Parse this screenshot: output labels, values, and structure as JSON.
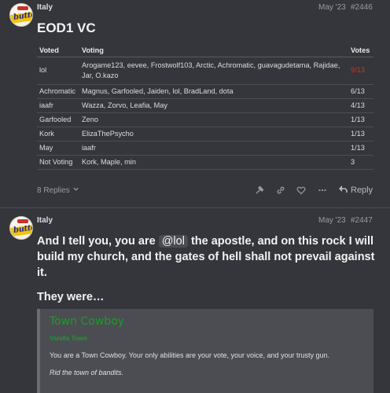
{
  "post1": {
    "username": "Italy",
    "date": "May '23",
    "post_number": "#2446",
    "title": "EOD1 VC",
    "table": {
      "headers": [
        "Voted",
        "Voting",
        "Votes"
      ],
      "rows": [
        {
          "voted": "lol",
          "voting": "Arogame123, eevee, Frostwolf103, Arctic, Achromatic, guavagudetama, Rajidae, Jar, O.kazo",
          "votes": "9/13"
        },
        {
          "voted": "Achromatic",
          "voting": "Magnus, Garfooled, Jaiden, lol, BradLand, dota",
          "votes": "6/13"
        },
        {
          "voted": "iaafr",
          "voting": "Wazza, Zorvo, Leafia, May",
          "votes": "4/13"
        },
        {
          "voted": "Garfooled",
          "voting": "Zeno",
          "votes": "1/13"
        },
        {
          "voted": "Kork",
          "voting": "ElizaThePsycho",
          "votes": "1/13"
        },
        {
          "voted": "May",
          "voting": "iaafr",
          "votes": "1/13"
        },
        {
          "voted": "Not Voting",
          "voting": "Kork, Maple, min",
          "votes": "3"
        }
      ]
    },
    "replies_label": "8 Replies",
    "reply_label": "Reply"
  },
  "post2": {
    "username": "Italy",
    "date": "May '23",
    "post_number": "#2447",
    "text_before": "And I tell you, you are ",
    "mention": "@lol",
    "text_after": " the apostle, and on this rock I will build my church, and the gates of hell shall not prevail against it.",
    "they_were": "They were…",
    "quote": {
      "title": "Town Cowboy",
      "subtitle": "Vanilla Town",
      "body": "You are a Town Cowboy. Your only abilities are your vote, your voice, and your trusty gun.",
      "goal": "Rid the town of bandits."
    }
  },
  "colors": {
    "background": "#34363b",
    "highlight_votes": "#e0291c",
    "role_green": "#1c9b2a"
  }
}
